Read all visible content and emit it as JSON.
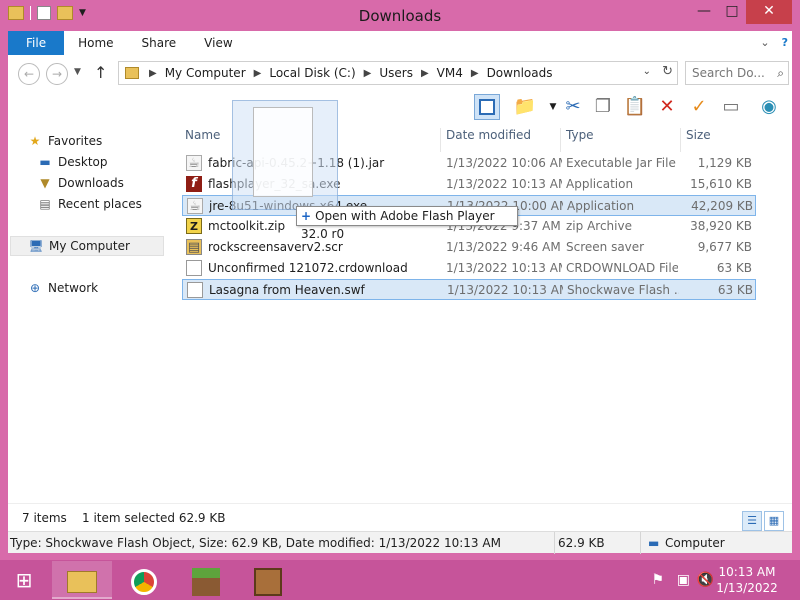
{
  "window": {
    "title": "Downloads"
  },
  "ribbon": {
    "tabs": [
      "File",
      "Home",
      "Share",
      "View"
    ]
  },
  "address": {
    "crumbs": [
      "My Computer",
      "Local Disk (C:)",
      "Users",
      "VM4",
      "Downloads"
    ],
    "search_placeholder": "Search Do..."
  },
  "nav": {
    "favorites": "Favorites",
    "desktop": "Desktop",
    "downloads": "Downloads",
    "recent": "Recent places",
    "computer": "My Computer",
    "network": "Network"
  },
  "columns": {
    "name": "Name",
    "date": "Date modified",
    "type": "Type",
    "size": "Size"
  },
  "files": [
    {
      "name": "fabric-api-0.45.2+1.18 (1).jar",
      "date": "1/13/2022 10:06 AM",
      "type": "Executable Jar File",
      "size": "1,129 KB",
      "icon": "jar-icon"
    },
    {
      "name": "flashplayer_32_sa.exe",
      "date": "1/13/2022 10:13 AM",
      "type": "Application",
      "size": "15,610 KB",
      "icon": "flash-icon"
    },
    {
      "name": "jre-8u51-windows-x64.exe",
      "date": "1/13/2022 10:00 AM",
      "type": "Application",
      "size": "42,209 KB",
      "icon": "java-icon"
    },
    {
      "name": "mctoolkit.zip",
      "date": "1/13/2022 9:37 AM",
      "type": "zip Archive",
      "size": "38,920 KB",
      "icon": "zip-icon"
    },
    {
      "name": "rockscreensaverv2.scr",
      "date": "1/13/2022 9:46 AM",
      "type": "Screen saver",
      "size": "9,677 KB",
      "icon": "screensaver-icon"
    },
    {
      "name": "Unconfirmed 121072.crdownload",
      "date": "1/13/2022 10:13 AM",
      "type": "CRDOWNLOAD File",
      "size": "63 KB",
      "icon": "file-icon"
    },
    {
      "name": "Lasagna from Heaven.swf",
      "date": "1/13/2022 10:13 AM",
      "type": "Shockwave Flash ...",
      "size": "63 KB",
      "icon": "swf-icon"
    }
  ],
  "drag": {
    "tooltip": "Open with Adobe Flash Player 32.0 r0"
  },
  "status": {
    "items": "7 items",
    "selected": "1 item selected  62.9 KB"
  },
  "details": {
    "text": "Type: Shockwave Flash Object, Size: 62.9 KB, Date modified: 1/13/2022 10:13 AM",
    "size": "62.9 KB",
    "location": "Computer"
  },
  "clock": {
    "time": "10:13 AM",
    "date": "1/13/2022"
  }
}
